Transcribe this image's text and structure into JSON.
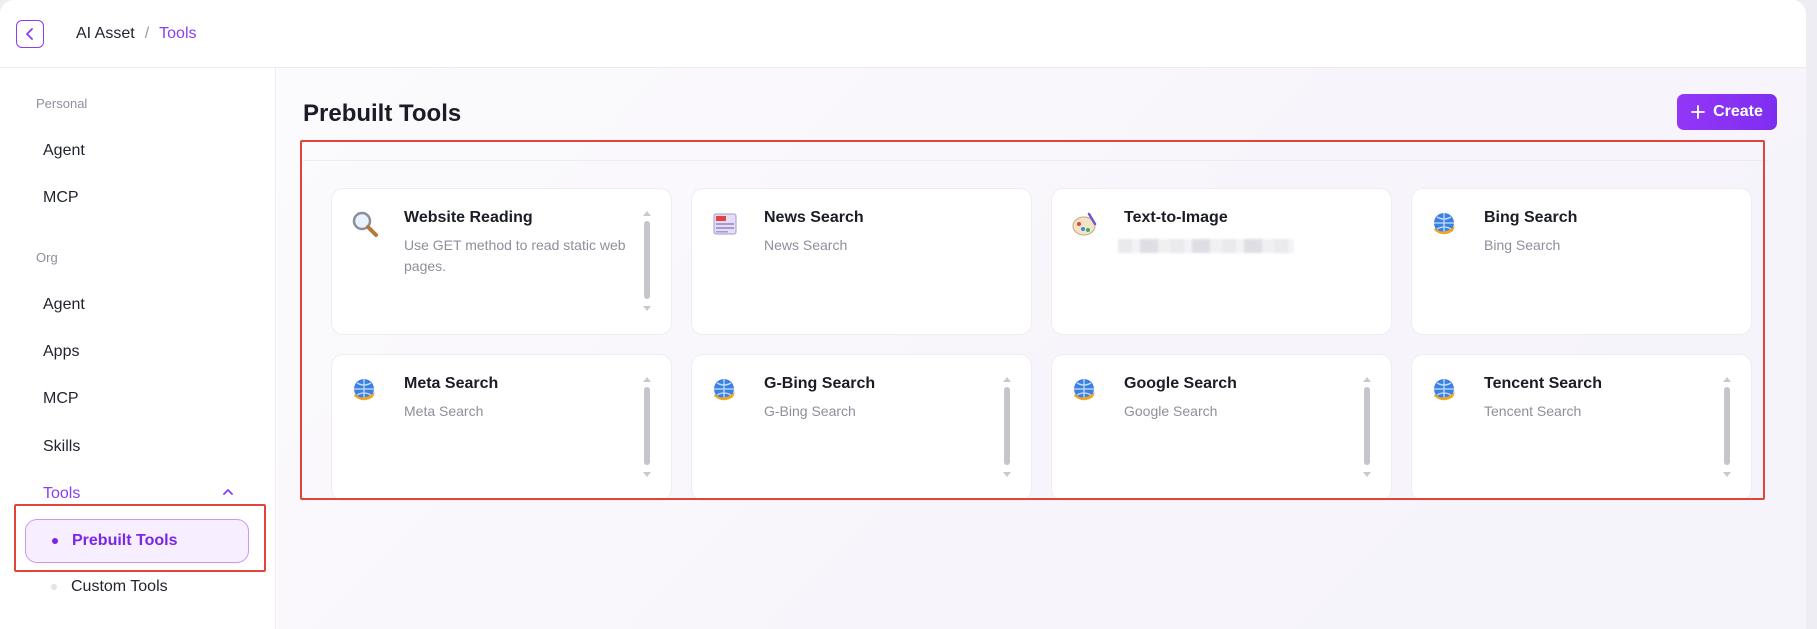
{
  "breadcrumb": {
    "root": "AI Asset",
    "separator": "/",
    "current": "Tools"
  },
  "sidebar": {
    "personal_label": "Personal",
    "personal_items": [
      "Agent",
      "MCP"
    ],
    "org_label": "Org",
    "org_items": [
      "Agent",
      "Apps",
      "MCP",
      "Skills"
    ],
    "tools_label": "Tools",
    "tools_subitems": [
      "Prebuilt Tools",
      "Custom Tools"
    ],
    "active_subitem": "Prebuilt Tools"
  },
  "main": {
    "title": "Prebuilt Tools",
    "create_label": "Create"
  },
  "tools": [
    {
      "name": "Website Reading",
      "description": "Use GET method to read static web pages.",
      "icon": "magnifier-icon"
    },
    {
      "name": "News Search",
      "description": "News Search",
      "icon": "newspaper-icon"
    },
    {
      "name": "Text-to-Image",
      "description": "",
      "icon": "palette-icon"
    },
    {
      "name": "Bing Search",
      "description": "Bing Search",
      "icon": "globe-icon"
    },
    {
      "name": "Meta Search",
      "description": "Meta Search",
      "icon": "globe-icon"
    },
    {
      "name": "G-Bing Search",
      "description": "G-Bing Search",
      "icon": "globe-icon"
    },
    {
      "name": "Google Search",
      "description": "Google Search",
      "icon": "globe-icon"
    },
    {
      "name": "Tencent Search",
      "description": "Tencent Search",
      "icon": "globe-icon"
    }
  ],
  "colors": {
    "accent": "#8a3df5",
    "highlight": "#e0453a"
  }
}
